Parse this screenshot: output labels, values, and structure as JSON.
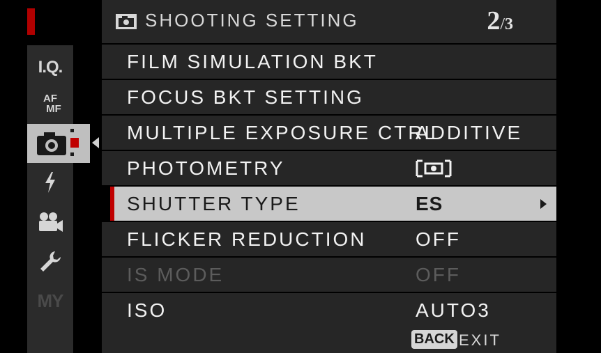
{
  "header": {
    "title": "SHOOTING SETTING",
    "page_current": "2",
    "page_separator": "/",
    "page_total": "3"
  },
  "sidebar": {
    "items": [
      {
        "label": "I.Q."
      },
      {
        "label_top": "AF",
        "label_bottom": "MF"
      },
      {
        "icon": "camera-icon",
        "active": true
      },
      {
        "icon": "flash-icon"
      },
      {
        "icon": "movie-camera-icon"
      },
      {
        "icon": "wrench-icon"
      },
      {
        "label": "MY",
        "dimmed": true
      }
    ]
  },
  "menu": {
    "rows": [
      {
        "label": "FILM SIMULATION BKT",
        "value": ""
      },
      {
        "label": "FOCUS BKT SETTING",
        "value": ""
      },
      {
        "label": "MULTIPLE EXPOSURE CTRL",
        "value": "ADDITIVE"
      },
      {
        "label": "PHOTOMETRY",
        "value_icon": "multi-metering-icon"
      },
      {
        "label": "SHUTTER TYPE",
        "value": "ES",
        "selected": true
      },
      {
        "label": "FLICKER REDUCTION",
        "value": "OFF"
      },
      {
        "label": "IS MODE",
        "value": "OFF",
        "disabled": true
      },
      {
        "label": "ISO",
        "value": "AUTO3"
      }
    ]
  },
  "footer": {
    "back_label": "BACK",
    "exit_label": "EXIT"
  },
  "colors": {
    "background": "#000000",
    "row_background": "#262626",
    "selected_row": "#c8c8c8",
    "accent_red": "#c00000",
    "disabled_text": "#5c5c5c"
  }
}
